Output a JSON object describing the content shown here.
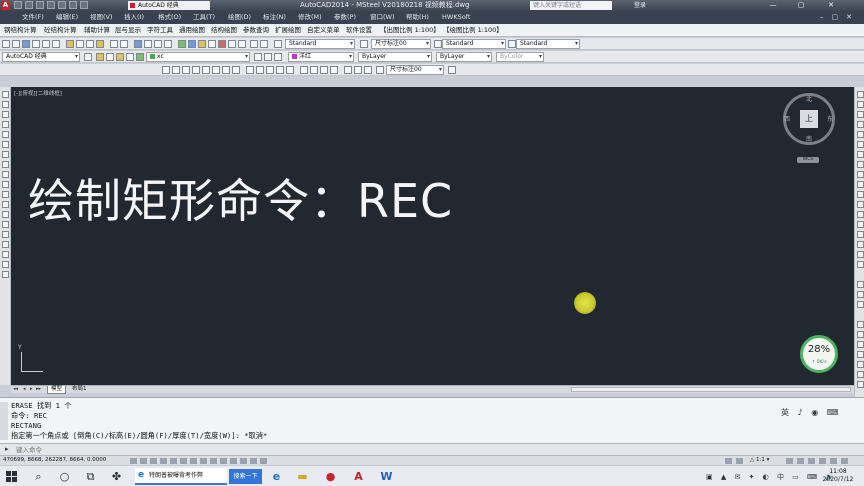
{
  "titlebar": {
    "workspace": "AutoCAD 经典",
    "window_title": "AutoCAD2014 - MSteel V20180218   视频教程.dwg",
    "search_placeholder": "键入关键字或短语",
    "login": "登录"
  },
  "menu": {
    "items": [
      "文件(F)",
      "编辑(E)",
      "视图(V)",
      "插入(I)",
      "格式(O)",
      "工具(T)",
      "绘图(D)",
      "标注(N)",
      "修改(M)",
      "参数(P)",
      "窗口(W)",
      "帮助(H)",
      "HWKSoft"
    ]
  },
  "ribbon": {
    "tabs": [
      "钢结构计算",
      "砼结构计算",
      "辅助计算",
      "层与显示",
      "字符工具",
      "通用绘图",
      "结构绘图",
      "参数查询",
      "扩展绘图",
      "自定义菜单",
      "软件设置",
      "【出图比例 1:100】",
      "【绘图比例 1:100】"
    ]
  },
  "toolbar1": {
    "text_style": "Standard",
    "dim_style": "尺寸标注00",
    "table_style": "Standard",
    "multileader_style": "Standard"
  },
  "toolbar2": {
    "workspace": "AutoCAD 经典",
    "layer": "xc",
    "color": "洋红",
    "linetype": "ByLayer",
    "lineweight": "ByLayer",
    "plotstyle": "ByColor",
    "dim_style": "尺寸标注00"
  },
  "drawing": {
    "viewport_label": "[-][俯视][二维线框]",
    "heading": "绘制矩形命令：REC",
    "viewcube": {
      "top": "上",
      "north": "北",
      "south": "南",
      "east": "东",
      "west": "西"
    },
    "wcs_label": "WCS",
    "ucs_y": "Y"
  },
  "gauge": {
    "percent": "28%",
    "speed": "↑ 0K/s"
  },
  "layout_tabs": [
    "模型",
    "布局1"
  ],
  "command_history": [
    "ERASE 找到 1 个",
    "命令: REC",
    "RECTANG",
    "指定第一个角点或 [倒角(C)/标高(E)/圆角(F)/厚度(T)/宽度(W)]: *取消*"
  ],
  "ime": "英 ♪ ◉ ⌨",
  "command_input": {
    "prompt": "▸",
    "placeholder": "键入命令"
  },
  "status": {
    "coords": "470699, 8668, 262287, 8664, 0.0000",
    "scale": "△ 1:1 ▾"
  },
  "taskbar": {
    "task_tab": "特朗普被曝背考作弊",
    "search_button": "搜索一下",
    "time": "11:08",
    "date": "2020/7/12"
  },
  "colors": {
    "canvas": "#212830",
    "layer_swatch": "#d02cd0",
    "gauge_ring": "#4cb45c"
  }
}
